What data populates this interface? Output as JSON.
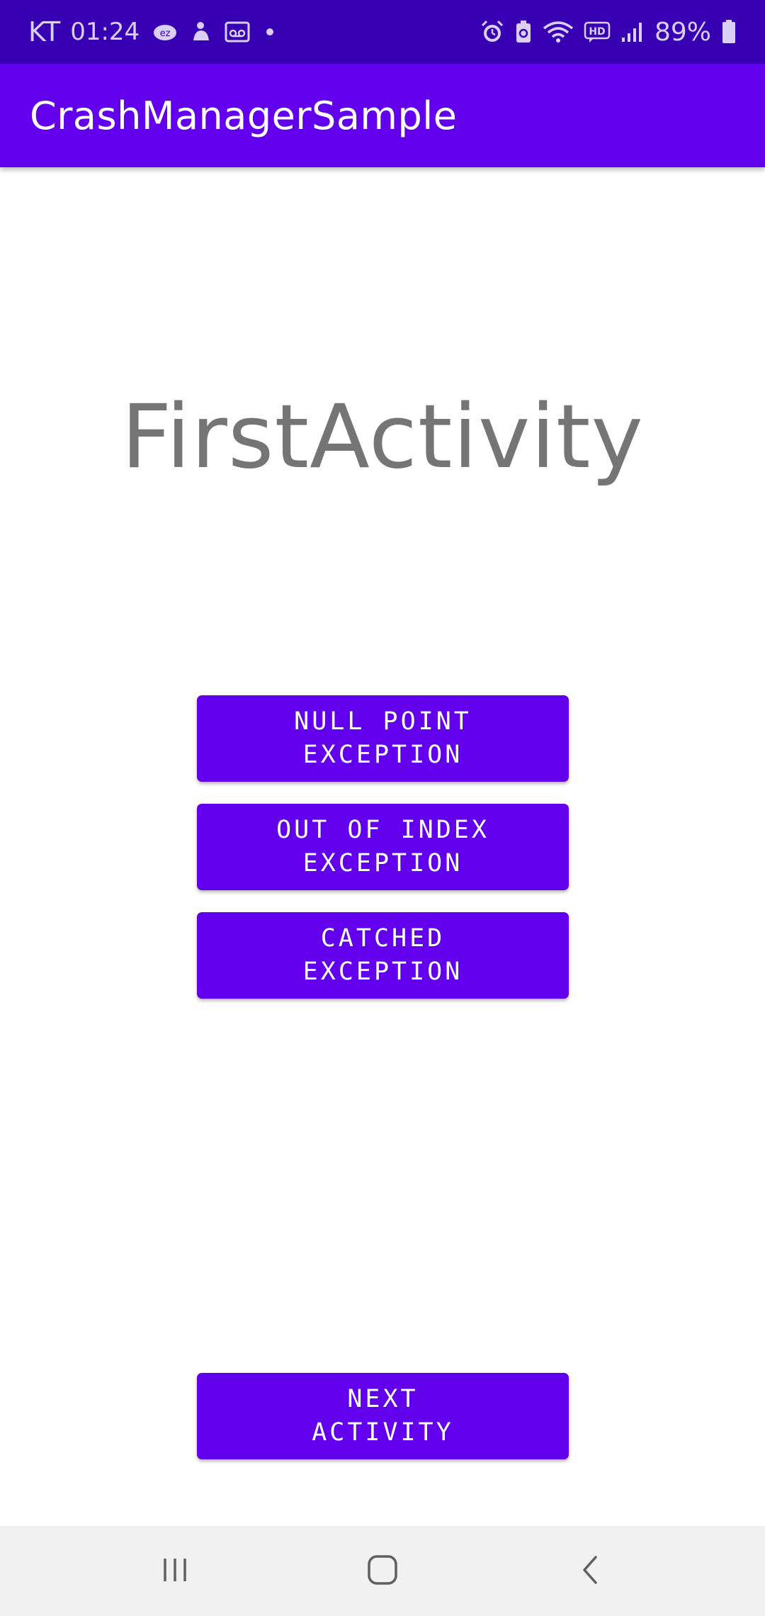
{
  "status_bar": {
    "carrier": "KT",
    "time": "01:24",
    "battery_percent": "89%",
    "left_icons": [
      "ez-cloud-icon",
      "user-notification-icon",
      "voicemail-icon",
      "dot-icon"
    ],
    "right_icons": [
      "alarm-icon",
      "battery-saver-icon",
      "wifi-icon",
      "hd-voice-icon",
      "signal-icon",
      "battery-icon"
    ],
    "colors": {
      "background": "#3700b3",
      "foreground": "#d9cff7"
    }
  },
  "app_bar": {
    "title": "CrashManagerSample",
    "color": "#6200ee"
  },
  "main": {
    "heading": "FirstActivity",
    "buttons": {
      "null_point": "NULL POINT\nEXCEPTION",
      "out_of_index": "OUT OF INDEX\nEXCEPTION",
      "catched": "CATCHED\nEXCEPTION",
      "next_activity": "NEXT\nACTIVITY"
    },
    "accent_color": "#6200ee"
  },
  "nav_bar": {
    "items": [
      "recents-icon",
      "home-icon",
      "back-icon"
    ]
  }
}
